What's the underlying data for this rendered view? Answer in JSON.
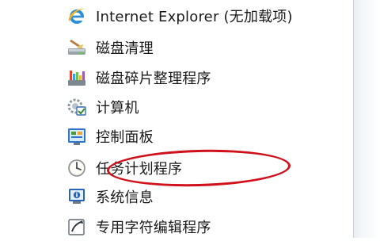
{
  "menu": {
    "items": [
      {
        "label": "Internet Explorer (无加载项)",
        "icon": "internet-explorer-icon"
      },
      {
        "label": "磁盘清理",
        "icon": "disk-cleanup-icon"
      },
      {
        "label": "磁盘碎片整理程序",
        "icon": "disk-defragmenter-icon"
      },
      {
        "label": "计算机",
        "icon": "computer-icon"
      },
      {
        "label": "控制面板",
        "icon": "control-panel-icon"
      },
      {
        "label": "任务计划程序",
        "icon": "task-scheduler-icon"
      },
      {
        "label": "系统信息",
        "icon": "system-information-icon"
      },
      {
        "label": "专用字符编辑程序",
        "icon": "private-character-editor-icon"
      }
    ]
  },
  "annotation": {
    "color": "#d0101a",
    "highlighted_item": "任务计划程序"
  }
}
